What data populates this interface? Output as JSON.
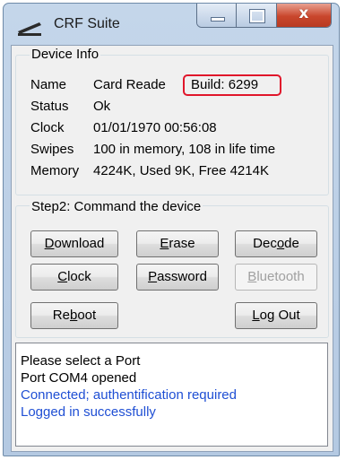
{
  "window": {
    "title": "CRF Suite",
    "caption": {
      "close": "x"
    }
  },
  "device_info": {
    "legend": "Device Info",
    "rows": [
      {
        "label": "Name",
        "value": "Card Reade"
      },
      {
        "label": "Status",
        "value": "Ok"
      },
      {
        "label": "Clock",
        "value": "01/01/1970 00:56:08"
      },
      {
        "label": "Swipes",
        "value": "100 in memory, 108 in life time"
      },
      {
        "label": "Memory",
        "value": "4224K, Used 9K, Free 4214K"
      }
    ],
    "build": "Build: 6299",
    "highlight_color": "#e0162b"
  },
  "command": {
    "legend": "Step2: Command the device",
    "buttons": {
      "download": {
        "mnemonic": "D",
        "rest": "ownload"
      },
      "erase": {
        "mnemonic": "E",
        "rest": "rase"
      },
      "decode": {
        "pre": "Dec",
        "mnemonic": "o",
        "rest": "de"
      },
      "clock": {
        "mnemonic": "C",
        "rest": "lock"
      },
      "password": {
        "mnemonic": "P",
        "rest": "assword"
      },
      "bluetooth": {
        "mnemonic": "B",
        "rest": "luetooth"
      },
      "reboot": {
        "pre": "Re",
        "mnemonic": "b",
        "rest": "oot"
      },
      "logout": {
        "mnemonic": "L",
        "rest": "og Out"
      }
    }
  },
  "log": {
    "lines": [
      {
        "text": "Please select a Port",
        "color": "#000000"
      },
      {
        "text": "Port COM4 opened",
        "color": "#000000"
      },
      {
        "text": "Connected; authentification required",
        "color": "#1f4fd4"
      },
      {
        "text": "Logged in successfully",
        "color": "#1f4fd4"
      }
    ]
  }
}
